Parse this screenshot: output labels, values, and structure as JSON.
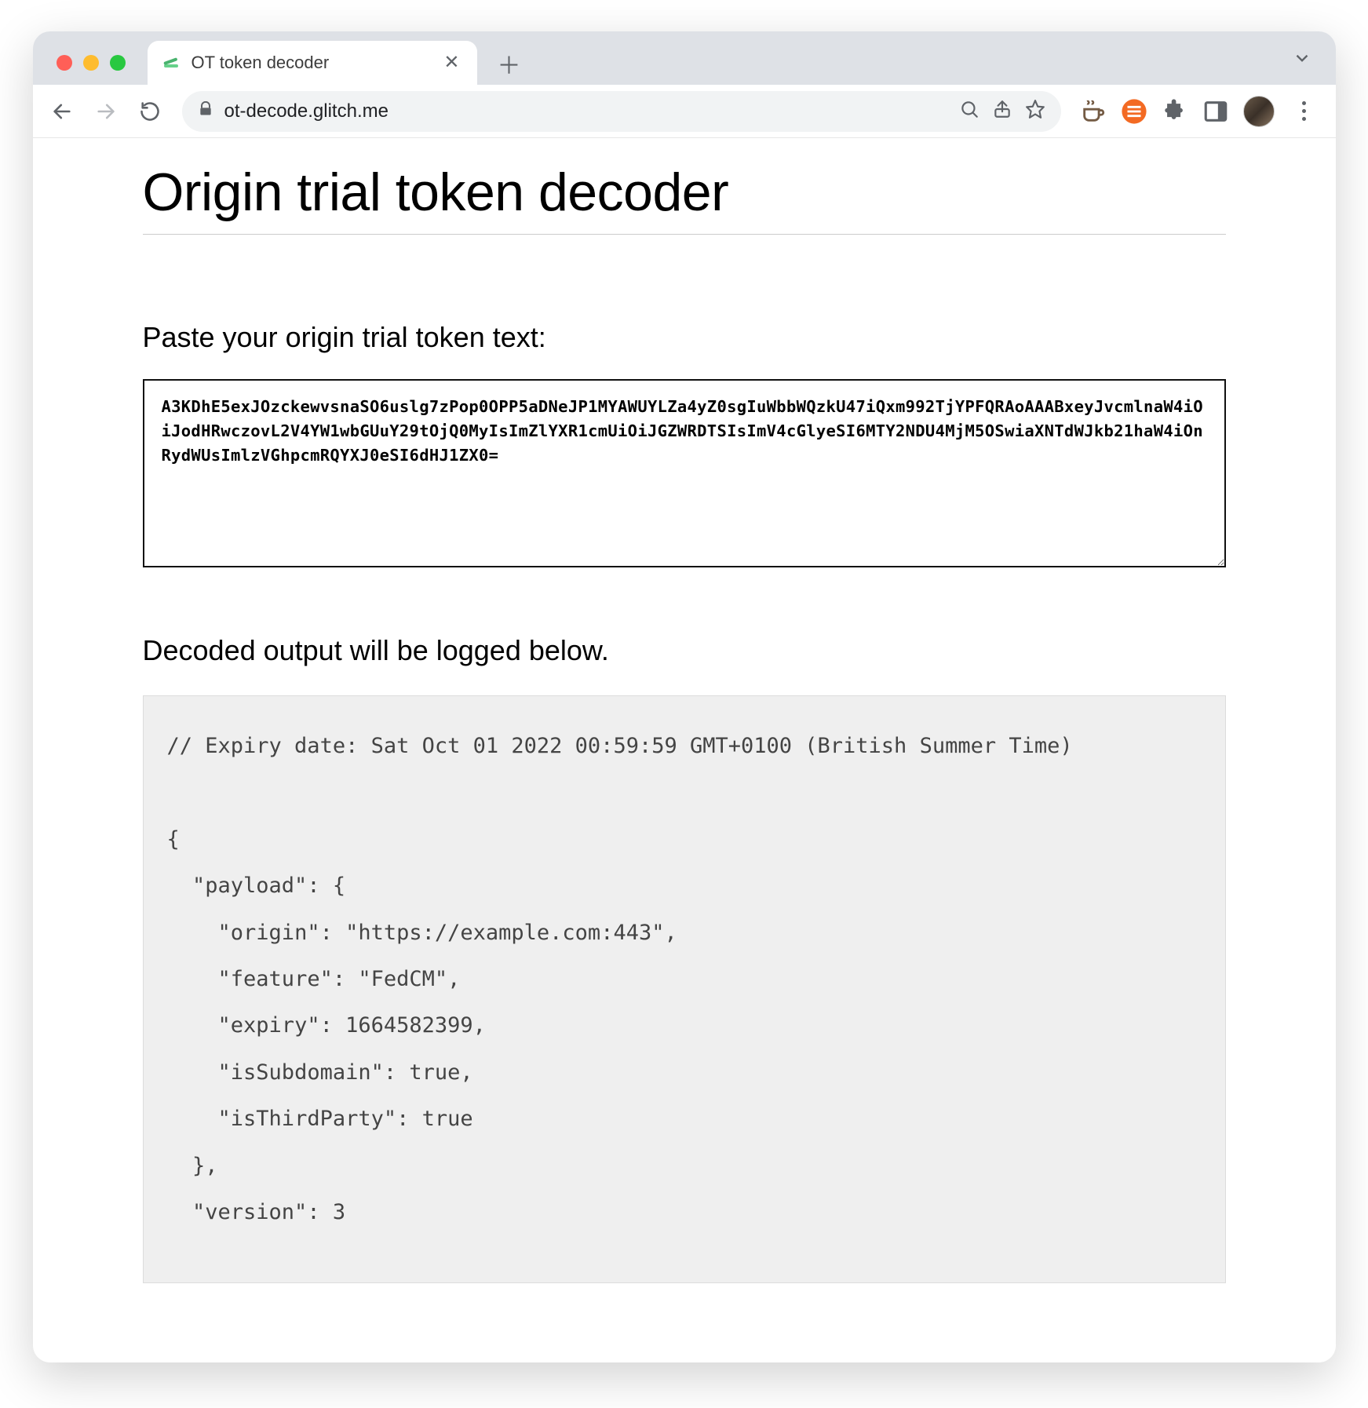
{
  "browser": {
    "tab_title": "OT token decoder",
    "url": "ot-decode.glitch.me"
  },
  "page": {
    "title": "Origin trial token decoder",
    "input_label": "Paste your origin trial token text:",
    "token_value": "A3KDhE5exJOzckewvsnaSO6uslg7zPop0OPP5aDNeJP1MYAWUYLZa4yZ0sgIuWbbWQzkU47iQxm992TjYPFQRAoAAABxeyJvcmlnaW4iOiJodHRwczovL2V4YW1wbGUuY29tOjQ0MyIsImZlYXR1cmUiOiJGZWRDTSIsImV4cGlyeSI6MTY2NDU4MjM5OSwiaXNTdWJkb21haW4iOnRydWUsImlzVGhpcmRQYXJ0eSI6dHJ1ZX0=",
    "output_label": "Decoded output will be logged below.",
    "output_text": "// Expiry date: Sat Oct 01 2022 00:59:59 GMT+0100 (British Summer Time)\n\n{\n  \"payload\": {\n    \"origin\": \"https://example.com:443\",\n    \"feature\": \"FedCM\",\n    \"expiry\": 1664582399,\n    \"isSubdomain\": true,\n    \"isThirdParty\": true\n  },\n  \"version\": 3"
  }
}
